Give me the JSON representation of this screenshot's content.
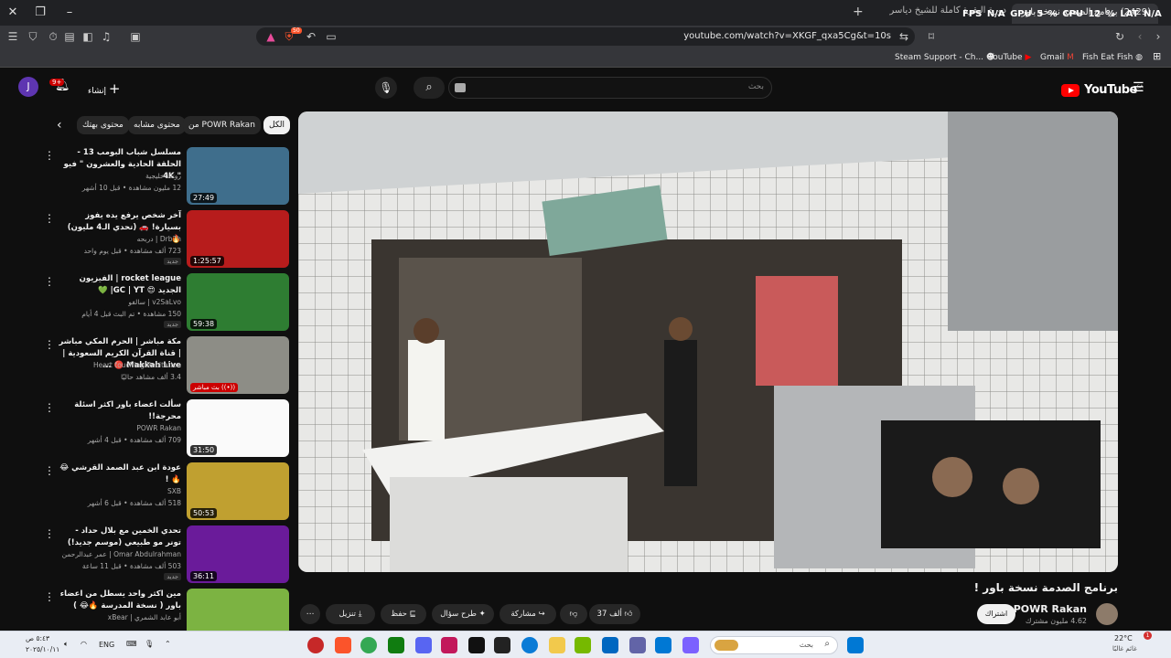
{
  "browser": {
    "tab_active_title": "(2429) برنامج الصدمة نسخة باور",
    "tab_2_title": "دورة البقرة كاملة للشيخ دياسر",
    "hud_fps": "FPS N/A",
    "hud_gpu": "GPU 5 %",
    "hud_cpu": "CPU 12 %",
    "hud_lat": "LAT N/A",
    "url": "youtube.com/watch?v=XKGF_qxa5Cg&t=10s",
    "shield_badge": "50",
    "bookmarks": [
      "Steam Support - Ch...",
      "YouTube",
      "Gmail",
      "Fish Eat Fish"
    ]
  },
  "youtube": {
    "logo_text": "YouTube",
    "logo_region": "SA",
    "search_placeholder": "بحث",
    "create_label": "إنشاء",
    "notif_count": "9+",
    "avatar_letter": "J",
    "chips": [
      "الكل",
      "من POWR Rakan",
      "محتوى مشابه",
      "محتوى بهتك"
    ],
    "recommendations": [
      {
        "title": "مسلسل شباب البومب 13 - الحلقة الحادية والعشرون \" فيو \" 4K",
        "channel": "روتانا خليجية",
        "meta": "12 مليون مشاهدة • قبل 10 أشهر",
        "duration": "27:49",
        "tag": ""
      },
      {
        "title": "آخر شخص يرفع يده يفوز بسيارة! 🚗 (تحدي الـ4 مليون) 🔥",
        "channel": "Drb7h | دربحه",
        "meta": "723 ألف مشاهدة • قبل يوم واحد",
        "duration": "1:25:57",
        "tag": "جديد"
      },
      {
        "title": "rocket league | الفيزيون الجديد 😍 GC | YT| 💚",
        "channel": "v2SaLvo | سالفو",
        "meta": "150 مشاهدة • تم البث قبل 4 أيام",
        "duration": "59:38",
        "tag": "جديد"
      },
      {
        "title": "مكة مباشر | الحرم المكي مباشر | قناة القرآن الكريم السعودية | Makkah Live 🔴 ...",
        "channel": "Heart touching Recitation",
        "meta": "3.4 ألف مشاهد حاليًا",
        "duration": "",
        "live": "بث مباشر ((•))",
        "tag": ""
      },
      {
        "title": "سألت اعضاء باور اكثر اسئلة محرجة!!",
        "channel": "POWR Rakan",
        "meta": "709 ألف مشاهدة • قبل 4 أشهر",
        "duration": "31:50",
        "tag": ""
      },
      {
        "title": "عودة ابن عبد الصمد القرشي 😂🔥 !",
        "channel": "SXB",
        "meta": "518 ألف مشاهدة • قبل 6 أشهر",
        "duration": "50:53",
        "tag": ""
      },
      {
        "title": "تحدي الخمين مع بلال حداد - تونر مو طبيعي (موسم جديد!)",
        "channel": "Omar Abdulrahman | عمر عبدالرحمن",
        "meta": "503 ألف مشاهدة • قبل 11 ساعة",
        "duration": "36:11",
        "tag": "جديد"
      },
      {
        "title": "مين اكثر واحد يسطل من اعضاء باور ( نسخة المدرسة 🔥😂 )",
        "channel": "أبو عابد الشمري | xBear",
        "meta": "",
        "duration": "",
        "tag": ""
      }
    ],
    "video": {
      "title": "برنامج الصدمة نسخة باور !",
      "owner_name": "POWR Rakan",
      "owner_subs": "4.62 مليون مشترك",
      "subscribe_label": "اشتراك",
      "like_count": "37 ألف",
      "share_label": "مشاركة",
      "ask_label": "طرح سؤال",
      "save_label": "حفظ",
      "download_label": "تنزيل"
    }
  },
  "taskbar": {
    "search_placeholder": "بحث",
    "lang": "ENG",
    "time": "٥:٤٣ ص",
    "date": "٢٠٢٥/١٠/١١",
    "weather_temp": "22°C",
    "weather_desc": "غائم غالبًا",
    "weather_badge": "1"
  }
}
